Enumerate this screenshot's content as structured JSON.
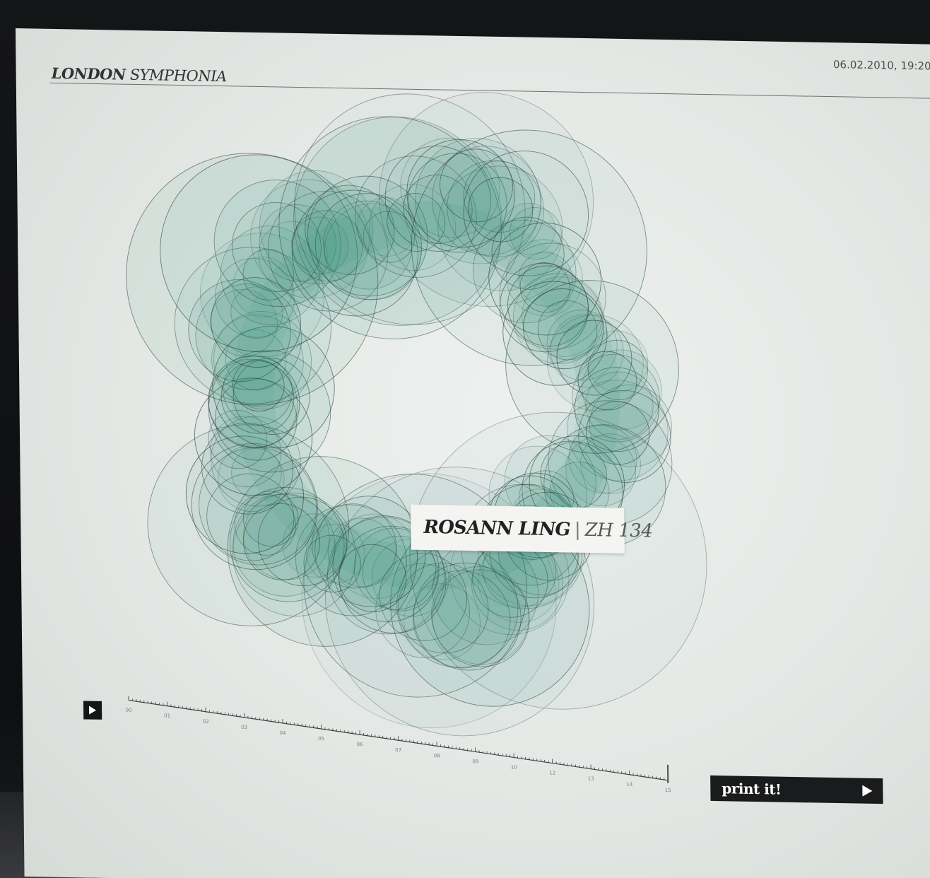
{
  "header": {
    "brand_bold": "LONDON",
    "brand_light": "SYMPHONIA",
    "datetime": "06.02.2010, 19:20"
  },
  "label": {
    "name": "ROSANN LING",
    "separator": "|",
    "code": "ZH 134"
  },
  "player": {
    "play_icon": "play-icon",
    "timeline_ticks": [
      "00",
      "01",
      "02",
      "03",
      "04",
      "05",
      "06",
      "07",
      "08",
      "09",
      "10",
      "12",
      "13",
      "14",
      "15"
    ]
  },
  "print": {
    "label": "print it!",
    "icon": "play-arrow-icon"
  },
  "colors": {
    "accent": "#2f8f78",
    "ink": "#1a1b1c",
    "screen": "#e6eae7"
  }
}
